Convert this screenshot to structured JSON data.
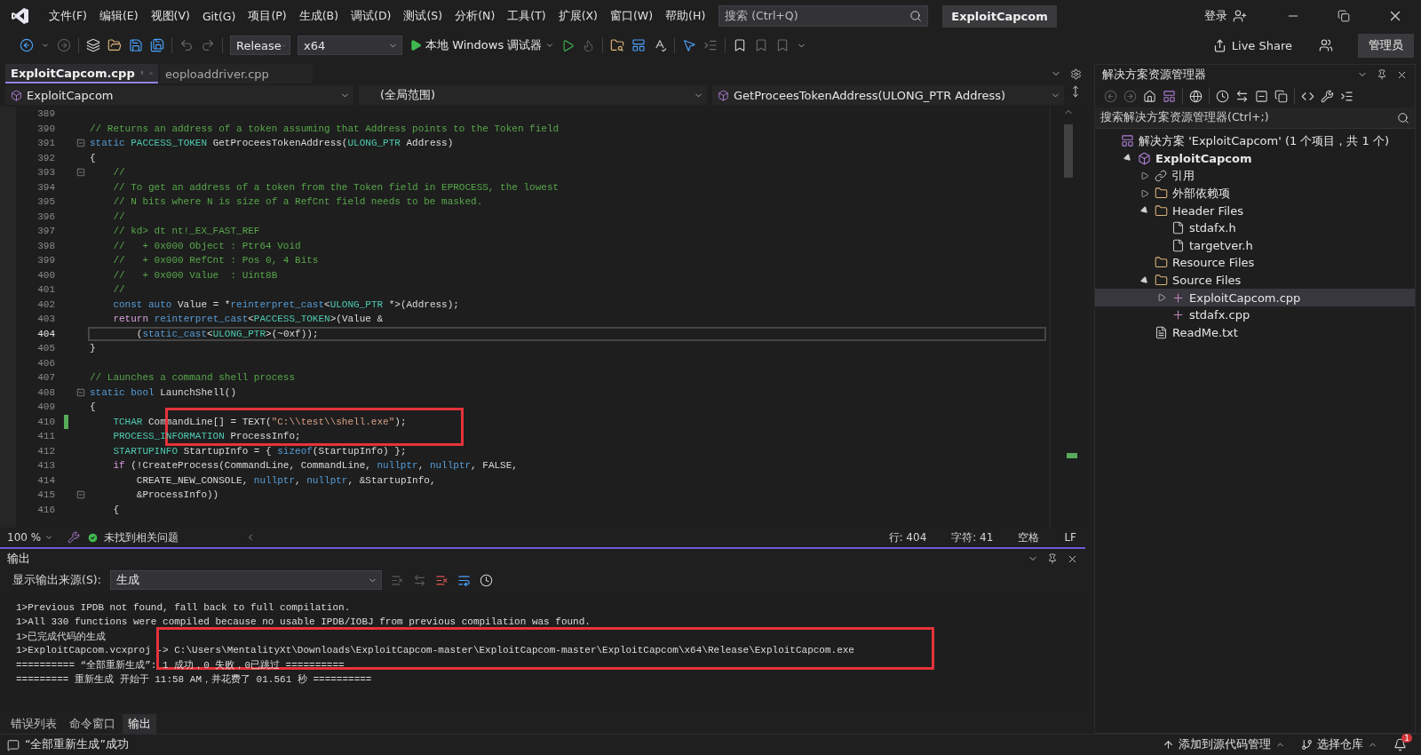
{
  "menu": [
    "文件(F)",
    "编辑(E)",
    "视图(V)",
    "Git(G)",
    "项目(P)",
    "生成(B)",
    "调试(D)",
    "测试(S)",
    "分析(N)",
    "工具(T)",
    "扩展(X)",
    "窗口(W)",
    "帮助(H)"
  ],
  "search": {
    "placeholder": "搜索 (Ctrl+Q)"
  },
  "solution_title": "ExploitCapcom",
  "sign_in": "登录",
  "toolbar": {
    "configuration": "Release",
    "platform": "x64",
    "debugger": "本地 Windows 调试器",
    "live_share": "Live Share",
    "admin": "管理员"
  },
  "tabs": [
    {
      "label": "ExploitCapcom.cpp",
      "selected": true
    },
    {
      "label": "eoploaddriver.cpp",
      "selected": false
    }
  ],
  "navbar": {
    "project": "ExploitCapcom",
    "scope": "(全局范围)",
    "member": "GetProceesTokenAddress(ULONG_PTR Address)"
  },
  "code": [
    {
      "n": "389",
      "fold": false,
      "current": false,
      "changed": false,
      "marked": false
    },
    {
      "n": "390",
      "fold": false,
      "current": false,
      "changed": false,
      "marked": false,
      "tokens": [
        {
          "kind": "c",
          "text": "// Returns an address of a token assuming that Address points to the Token field"
        }
      ]
    },
    {
      "n": "391",
      "fold": true,
      "current": false,
      "changed": false,
      "marked": false,
      "tokens": [
        {
          "kind": "k",
          "text": "static "
        },
        {
          "kind": "t",
          "text": "PACCESS_TOKEN"
        },
        {
          "kind": "p",
          "text": " GetProceesTokenAddress("
        },
        {
          "kind": "t",
          "text": "ULONG_PTR"
        },
        {
          "kind": "p",
          "text": " Address)"
        }
      ]
    },
    {
      "n": "392",
      "fold": false,
      "current": false,
      "changed": false,
      "marked": false,
      "tokens": [
        {
          "kind": "p",
          "text": "{"
        }
      ]
    },
    {
      "n": "393",
      "fold": true,
      "current": false,
      "changed": false,
      "marked": false,
      "tokens": [
        {
          "kind": "c",
          "text": "    //"
        }
      ]
    },
    {
      "n": "394",
      "fold": false,
      "current": false,
      "changed": false,
      "marked": false,
      "tokens": [
        {
          "kind": "c",
          "text": "    // To get an address of a token from the Token field in EPROCESS, the lowest"
        }
      ]
    },
    {
      "n": "395",
      "fold": false,
      "current": false,
      "changed": false,
      "marked": false,
      "tokens": [
        {
          "kind": "c",
          "text": "    // N bits where N is size of a RefCnt field needs to be masked."
        }
      ]
    },
    {
      "n": "396",
      "fold": false,
      "current": false,
      "changed": false,
      "marked": false,
      "tokens": [
        {
          "kind": "c",
          "text": "    //"
        }
      ]
    },
    {
      "n": "397",
      "fold": false,
      "current": false,
      "changed": false,
      "marked": false,
      "tokens": [
        {
          "kind": "c",
          "text": "    // kd> dt nt!_EX_FAST_REF"
        }
      ]
    },
    {
      "n": "398",
      "fold": false,
      "current": false,
      "changed": false,
      "marked": false,
      "tokens": [
        {
          "kind": "c",
          "text": "    //   + 0x000 Object : Ptr64 Void"
        }
      ]
    },
    {
      "n": "399",
      "fold": false,
      "current": false,
      "changed": false,
      "marked": false,
      "tokens": [
        {
          "kind": "c",
          "text": "    //   + 0x000 RefCnt : Pos 0, 4 Bits"
        }
      ]
    },
    {
      "n": "400",
      "fold": false,
      "current": false,
      "changed": false,
      "marked": false,
      "tokens": [
        {
          "kind": "c",
          "text": "    //   + 0x000 Value  : Uint8B"
        }
      ]
    },
    {
      "n": "401",
      "fold": false,
      "current": false,
      "changed": false,
      "marked": false,
      "tokens": [
        {
          "kind": "c",
          "text": "    //"
        }
      ]
    },
    {
      "n": "402",
      "fold": false,
      "current": false,
      "changed": false,
      "marked": false,
      "tokens": [
        {
          "kind": "k",
          "text": "    const auto"
        },
        {
          "kind": "p",
          "text": " Value = *"
        },
        {
          "kind": "k",
          "text": "reinterpret_cast"
        },
        {
          "kind": "p",
          "text": "<"
        },
        {
          "kind": "t",
          "text": "ULONG_PTR"
        },
        {
          "kind": "p",
          "text": " *>(Address);"
        }
      ]
    },
    {
      "n": "403",
      "fold": false,
      "current": false,
      "changed": false,
      "marked": false,
      "tokens": [
        {
          "kind": "r",
          "text": "    return "
        },
        {
          "kind": "k",
          "text": "reinterpret_cast"
        },
        {
          "kind": "p",
          "text": "<"
        },
        {
          "kind": "t",
          "text": "PACCESS_TOKEN"
        },
        {
          "kind": "p",
          "text": ">(Value &"
        }
      ]
    },
    {
      "n": "404",
      "fold": false,
      "current": true,
      "changed": false,
      "marked": false,
      "tokens": [
        {
          "kind": "p",
          "text": "        ("
        },
        {
          "kind": "k",
          "text": "static_cast"
        },
        {
          "kind": "p",
          "text": "<"
        },
        {
          "kind": "t",
          "text": "ULONG_PTR"
        },
        {
          "kind": "p",
          "text": ">(~0xf));"
        }
      ]
    },
    {
      "n": "405",
      "fold": false,
      "current": false,
      "changed": false,
      "marked": false,
      "tokens": [
        {
          "kind": "p",
          "text": "}"
        }
      ]
    },
    {
      "n": "406",
      "fold": false,
      "current": false,
      "changed": false,
      "marked": false
    },
    {
      "n": "407",
      "fold": false,
      "current": false,
      "changed": false,
      "marked": false,
      "tokens": [
        {
          "kind": "c",
          "text": "// Launches a command shell process"
        }
      ]
    },
    {
      "n": "408",
      "fold": true,
      "current": false,
      "changed": false,
      "marked": false,
      "tokens": [
        {
          "kind": "k",
          "text": "static bool"
        },
        {
          "kind": "p",
          "text": " LaunchShell()"
        }
      ]
    },
    {
      "n": "409",
      "fold": false,
      "current": false,
      "changed": false,
      "marked": false,
      "tokens": [
        {
          "kind": "p",
          "text": "{"
        }
      ]
    },
    {
      "n": "410",
      "fold": false,
      "current": false,
      "changed": true,
      "marked": true,
      "tokens": [
        {
          "kind": "t",
          "text": "    TCHAR"
        },
        {
          "kind": "p",
          "text": " CommandLine[] = TEXT("
        },
        {
          "kind": "s",
          "text": "\"C:\\\\test\\\\shell.exe\""
        },
        {
          "kind": "p",
          "text": ");"
        }
      ]
    },
    {
      "n": "411",
      "fold": false,
      "current": false,
      "changed": false,
      "marked": false,
      "tokens": [
        {
          "kind": "t",
          "text": "    PROCESS_INFORMATION"
        },
        {
          "kind": "p",
          "text": " ProcessInfo;"
        }
      ]
    },
    {
      "n": "412",
      "fold": false,
      "current": false,
      "changed": false,
      "marked": false,
      "tokens": [
        {
          "kind": "t",
          "text": "    STARTUPINFO"
        },
        {
          "kind": "p",
          "text": " StartupInfo = { "
        },
        {
          "kind": "k",
          "text": "sizeof"
        },
        {
          "kind": "p",
          "text": "(StartupInfo) };"
        }
      ]
    },
    {
      "n": "413",
      "fold": false,
      "current": false,
      "changed": false,
      "marked": false,
      "tokens": [
        {
          "kind": "r",
          "text": "    if"
        },
        {
          "kind": "p",
          "text": " (!CreateProcess(CommandLine, CommandLine, "
        },
        {
          "kind": "k",
          "text": "nullptr"
        },
        {
          "kind": "p",
          "text": ", "
        },
        {
          "kind": "k",
          "text": "nullptr"
        },
        {
          "kind": "p",
          "text": ", FALSE,"
        }
      ]
    },
    {
      "n": "414",
      "fold": false,
      "current": false,
      "changed": false,
      "marked": false,
      "tokens": [
        {
          "kind": "p",
          "text": "        CREATE_NEW_CONSOLE, "
        },
        {
          "kind": "k",
          "text": "nullptr"
        },
        {
          "kind": "p",
          "text": ", "
        },
        {
          "kind": "k",
          "text": "nullptr"
        },
        {
          "kind": "p",
          "text": ", &StartupInfo,"
        }
      ]
    },
    {
      "n": "415",
      "fold": true,
      "current": false,
      "changed": false,
      "marked": false,
      "tokens": [
        {
          "kind": "p",
          "text": "        &ProcessInfo))"
        }
      ]
    },
    {
      "n": "416",
      "fold": false,
      "current": false,
      "changed": false,
      "marked": false,
      "tokens": [
        {
          "kind": "p",
          "text": "    {"
        }
      ]
    }
  ],
  "editor_status": {
    "zoom": "100 %",
    "issues": "未找到相关问题",
    "line": "行: 404",
    "column": "字符: 41",
    "indent": "空格",
    "eol": "LF"
  },
  "output": {
    "title": "输出",
    "source_label": "显示输出来源(S):",
    "source": "生成",
    "lines": [
      {
        "text": "1>Previous IPDB not found, fall back to full compilation.",
        "marked": false
      },
      {
        "text": "1>All 330 functions were compiled because no usable IPDB/IOBJ from previous compilation was found.",
        "marked": false
      },
      {
        "text": "1>已完成代码的生成",
        "marked": false
      },
      {
        "text": "1>ExploitCapcom.vcxproj -> C:\\Users\\MentalityXt\\Downloads\\ExploitCapcom-master\\ExploitCapcom-master\\ExploitCapcom\\x64\\Release\\ExploitCapcom.exe",
        "marked": true
      },
      {
        "text": "========== “全部重新生成”: 1 成功，0 失败，0已跳过 ==========",
        "marked": false
      },
      {
        "text": "========= 重新生成 开始于 11:58 AM，并花费了 01.561 秒 ==========",
        "marked": false
      }
    ]
  },
  "bottom_tabs": [
    {
      "label": "错误列表",
      "selected": false
    },
    {
      "label": "命令窗口",
      "selected": false
    },
    {
      "label": "输出",
      "selected": true
    }
  ],
  "solution_explorer": {
    "title": "解决方案资源管理器",
    "search_placeholder": "搜索解决方案资源管理器(Ctrl+;)",
    "tree": [
      {
        "label": "解决方案 'ExploitCapcom' (1 个项目，共 1 个)",
        "kind": "solution",
        "selected": false,
        "children": [
          {
            "label": "ExploitCapcom",
            "kind": "project",
            "selected": false,
            "expanded": true,
            "children": [
              {
                "label": "引用",
                "kind": "references",
                "selected": false,
                "expanded": false
              },
              {
                "label": "外部依赖项",
                "kind": "external",
                "selected": false,
                "expanded": false
              },
              {
                "label": "Header Files",
                "kind": "folder",
                "selected": false,
                "expanded": true,
                "children": [
                  {
                    "label": "stdafx.h",
                    "kind": "header",
                    "selected": false
                  },
                  {
                    "label": "targetver.h",
                    "kind": "header",
                    "selected": false
                  }
                ]
              },
              {
                "label": "Resource Files",
                "kind": "folder",
                "selected": false
              },
              {
                "label": "Source Files",
                "kind": "folder",
                "selected": false,
                "expanded": true,
                "children": [
                  {
                    "label": "ExploitCapcom.cpp",
                    "kind": "source",
                    "selected": true,
                    "expanded": false
                  },
                  {
                    "label": "stdafx.cpp",
                    "kind": "source",
                    "selected": false
                  }
                ]
              },
              {
                "label": "ReadMe.txt",
                "kind": "text",
                "selected": false
              }
            ]
          }
        ]
      }
    ]
  },
  "status_bar": {
    "message": "“全部重新生成”成功",
    "source_control": "添加到源代码管理",
    "repository": "选择仓库",
    "notifications": "1"
  }
}
